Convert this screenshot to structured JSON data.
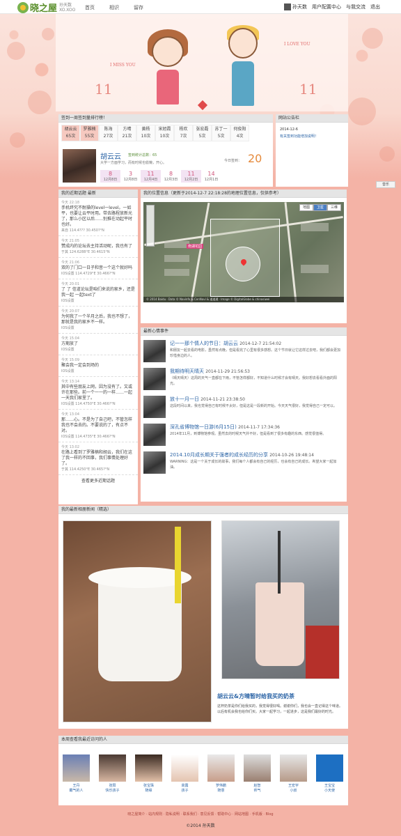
{
  "topbar": {
    "logo_text": "晓之屋",
    "logo_sub": "孙天数",
    "logo_sub2": "XO.XOO",
    "nav": [
      "首页",
      "相识",
      "留存"
    ],
    "user_name": "孙天数",
    "links": [
      "用户配置中心",
      "与我交流",
      "退出"
    ]
  },
  "hero": {
    "miss": "I MISS YOU",
    "love": "I LOVE YOU",
    "eleven_left": "11",
    "eleven_right": "11"
  },
  "checkin": {
    "title": "签到一周签到量排行榜！",
    "days": [
      {
        "name": "胡云云",
        "count": "65次"
      },
      {
        "name": "罗雅楠",
        "count": "55次"
      },
      {
        "name": "陈海",
        "count": "27次"
      },
      {
        "name": "方晴",
        "count": "21次"
      },
      {
        "name": "黄杨",
        "count": "10次"
      },
      {
        "name": "宋旭霞",
        "count": "10次"
      },
      {
        "name": "杨欢",
        "count": "7次"
      },
      {
        "name": "张宏磊",
        "count": "5次"
      },
      {
        "name": "苏丁一",
        "count": "5次"
      },
      {
        "name": "何俊阳",
        "count": "4次"
      }
    ],
    "featured": {
      "name": "胡云云",
      "tag": "签到统计总数：65",
      "desc": "大学一方面学习，而有时候也偷懒，开心。",
      "today_label": "今日签到：",
      "today_num": "20"
    },
    "daynums": [
      {
        "num": "8",
        "date": "12月8日"
      },
      {
        "num": "3",
        "date": "12月8日"
      },
      {
        "num": "11",
        "date": "12月4日"
      },
      {
        "num": "8",
        "date": "12月3日"
      },
      {
        "num": "11",
        "date": "12月2日"
      },
      {
        "num": "14",
        "date": "12月1日"
      }
    ]
  },
  "notice": {
    "title": "网站公告栏",
    "date": "2014-12-6",
    "text": "有关签到功能增加说明！"
  },
  "music": "音乐",
  "recent": {
    "title": "我的近期话题 最新",
    "items": [
      {
        "t": "今天 22:18",
        "m": "手机终究不耐操的level一level。一如平，也要让云平时用。带去路程放新光了，那么小区以后……别推在动起平时也好。",
        "s": "来自 114.4??? 30.450?°N"
      },
      {
        "t": "今天 21:05",
        "m": "赞成内的论坛去主持活动呢，我也有了",
        "s": "于其 124.6288°E 30.4615°N"
      },
      {
        "t": "今天 21:06",
        "m": "双的了门口一日子和音一个这个就好吗",
        "s": "IOS设置 114.4729°E 30.466?°N"
      },
      {
        "t": "今天 20:01",
        "m": "了 了 信道论坛是咱们来说的家乡，还是我一起 一起text了",
        "s": "IOS设置"
      },
      {
        "t": "今天 20:07",
        "m": "为何我了一个半月之后，我也不想了，那就是我的家乡不一样。",
        "s": "IOS设置"
      },
      {
        "t": "今天 15:04",
        "m": "方期放了",
        "s": "IOS设置"
      },
      {
        "t": "今天 15:09",
        "m": "聚会我一定会到场的",
        "s": "IOS设置"
      },
      {
        "t": "今天 13:14",
        "m": "其中有些朋友上网，因为没有了。又或许在那些。前一个一一的一样……一起一天我们家里了。",
        "s": "IOS设置 114.4750°E 30.466?°N"
      },
      {
        "t": "今天 13:04",
        "m": "那……心。不是为了自己吧，不管怎样我也不会去的。不要说的了，有点不对。",
        "s": "IOS设置 114.4735°E 30.466?°N"
      },
      {
        "t": "今天 13:02",
        "m": "在路上看到了罗雅楠和胡云，我们在这了我一样的不回事，我们事情处理好了。",
        "s": "于其 114.4250°E 30.465?°N"
      }
    ],
    "more": "查看更多近期话题"
  },
  "location": {
    "title": "我的位置信息（更新于2014-12-7 22:18:28的地理位置信息，仅供参考）",
    "map_label": "南湖花园",
    "switch": [
      "地图",
      "卫星",
      "三维"
    ],
    "copyright": "© 2014 Baidu · Data © Navinfo & CenNavi & 道道通 · Image © DigitalGlobe & chinasiwei"
  },
  "moods": {
    "title": "最新心情事件",
    "items": [
      {
        "title": "记一一那个情人的节日：胡云云",
        "date": "2014-12-7 21:54:02",
        "body": "和朋友一起去看的电影，虽然有点晚，但是看完了心里有很多感想。这个节日就让它这样过去吧，我们都会更加珍惜身边的人。"
      },
      {
        "title": "我期待明天晴天",
        "date": "2014-11-29 21:56:53",
        "body": "（晴天晴天）这周的天气一直都在下雨，不管怎样都好，不知道什么时候才会有晴天。我好想去看看外面的阳光。"
      },
      {
        "title": "放十一月一日",
        "date": "2014-11-21 23:38:50",
        "body": "这段时间以来，我也觉得自己有时候不太好，但是这是一段新的开始。今天天气很好，我觉得自己一定可以。"
      },
      {
        "title": "深孔省博物馆一日游(6月15日)",
        "date": "2014-11-7 17:34:36",
        "body": "2014年11月，到博物馆参观。虽然去的时候天气并不好，但是看到了很多有趣的东西。感觉很值得。"
      },
      {
        "title": "2014.10月成长期关于强者的成长经历的分享",
        "date": "2014-10-26 19:48:14",
        "body": "WARNING：这是一个关于成长的故事，我们每个人都会有自己的经历，也会有自己的成长。希望大家一起加油。"
      }
    ]
  },
  "photos": {
    "title": "我的最新相册新闻（精选）",
    "post_title": "胡云云&方晴暂时给我买的奶茶",
    "post_body": "这杯奶茶是你们给我买的，我觉得很好喝。谢谢你们，我也会一直记得这个味道。以后有机会我也给你们买。大家一起学习，一起进步，这是我们最好的时光。"
  },
  "visitors": {
    "title": "本周查看我最近访问的人",
    "users": [
      {
        "n1": "王丹",
        "n2": "霸气的人"
      },
      {
        "n1": "张阳",
        "n2": "快乐孩子"
      },
      {
        "n1": "张宝珠",
        "n2": "随缘"
      },
      {
        "n1": "高露",
        "n2": "孩子"
      },
      {
        "n1": "罗伟鹏",
        "n2": "随意"
      },
      {
        "n1": "赵智",
        "n2": "帅气"
      },
      {
        "n1": "王宏宇",
        "n2": "小叔"
      },
      {
        "n1": "王宝宝",
        "n2": "小天使"
      }
    ]
  },
  "footer": {
    "links": "晓之屋简介 · 站内规则 · 隐私说明 · 联系我们 · 意见反馈 · 帮助中心 · 网站地图 · 手机版 · Blog",
    "copy": "©2014 孙天数"
  }
}
